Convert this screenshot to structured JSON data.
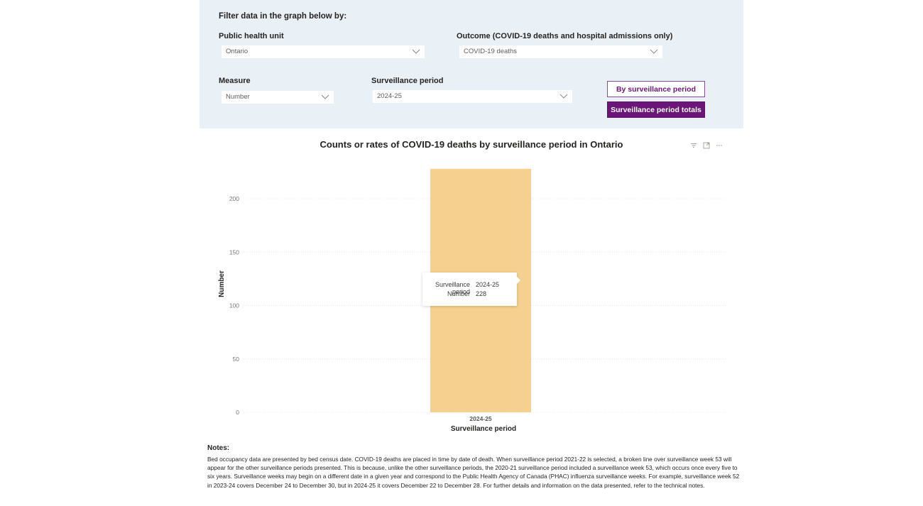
{
  "filters": {
    "heading": "Filter data in the graph below by:",
    "public_health_unit": {
      "label": "Public health unit",
      "value": "Ontario"
    },
    "outcome": {
      "label": "Outcome (COVID-19 deaths and hospital admissions only)",
      "value": "COVID-19 deaths"
    },
    "measure": {
      "label": "Measure",
      "value": "Number"
    },
    "surveillance_period": {
      "label": "Surveillance period",
      "value": "2024-25"
    },
    "buttons": {
      "by_period": "By surveillance period",
      "period_totals": "Surveillance period totals"
    }
  },
  "visual_header_icons": [
    "filter-icon",
    "focus-mode-icon",
    "more-options-icon"
  ],
  "colors": {
    "panel_bg": "#e9f0f6",
    "accent_purple": "#6b1579",
    "bar": "#f6d08e"
  },
  "tooltip": {
    "rows": [
      {
        "key": "Surveillance period",
        "value": "2024-25"
      },
      {
        "key": "Number",
        "value": "228"
      }
    ]
  },
  "chart_data": {
    "type": "bar",
    "title": "Counts or rates of COVID-19 deaths by surveillance period in Ontario",
    "xlabel": "Surveillance period",
    "ylabel": "Number",
    "categories": [
      "2024-25"
    ],
    "values": [
      228
    ],
    "ylim": [
      0,
      228
    ],
    "yticks": [
      0,
      50,
      100,
      150,
      200
    ],
    "grid": true,
    "legend": "none"
  },
  "notes": {
    "title": "Notes:",
    "body": "Bed occupancy data are presented by bed census date. COVID-19 deaths are placed in time by date of death. When surveillance period 2021-22 is selected, a broken line over surveillance week 53 will appear for the other surveillance periods presented. This is because, unlike the other surveillance periods, the 2020-21 surveillance period included a surveillance week 53, which occurs once every five to six years. Surveillance weeks may begin on a different date in a given year and correspond to the Public Health Agency of Canada (PHAC) influenza surveillance weeks. For example, surveillance week 52 in 2023-24 covers December 24 to December 30, but in 2024-25 it covers December 22 to December 28. For further details and information on the data presented, refer to the technical notes."
  }
}
